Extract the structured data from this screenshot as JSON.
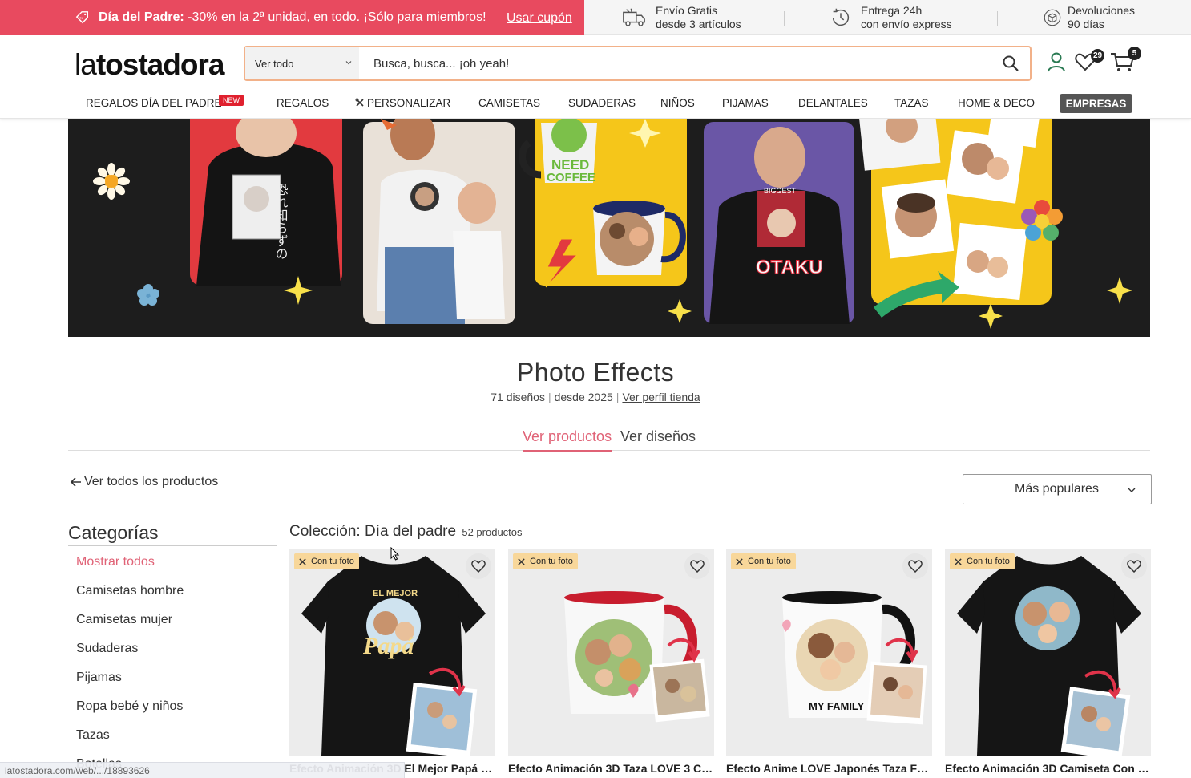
{
  "promo": {
    "bold": "Día del Padre:",
    "text": " -30% en la 2ª unidad, en todo. ¡Sólo para miembros!",
    "coupon": "Usar cupón"
  },
  "perks": [
    {
      "line1": "Envío Gratis",
      "line2": "desde 3 artículos",
      "icon": "truck-icon"
    },
    {
      "line1": "Entrega 24h",
      "line2": "con envío express",
      "icon": "clock-icon"
    },
    {
      "line1": "Devoluciones",
      "line2": "90 días",
      "icon": "box-icon"
    }
  ],
  "header": {
    "logo_light": "la",
    "logo_bold": "tostadora",
    "search_category": "Ver todo",
    "search_placeholder": "Busca, busca... ¡oh yeah!",
    "wishlist_count": "29",
    "cart_count": "5"
  },
  "nav": {
    "items": [
      "REGALOS DÍA DEL PADRE",
      "REGALOS",
      "PERSONALIZAR",
      "CAMISETAS",
      "SUDADERAS",
      "NIÑOS",
      "PIJAMAS",
      "DELANTALES",
      "TAZAS",
      "HOME & DECO"
    ],
    "new_badge": "NEW",
    "empresas": "EMPRESAS"
  },
  "store": {
    "title": "Photo Effects",
    "designs": "71 diseños",
    "since": "desde 2025",
    "profile_link": "Ver perfil tienda"
  },
  "tabs": {
    "products": "Ver productos",
    "designs": "Ver diseños"
  },
  "back_link": "Ver todos los productos",
  "sort": {
    "selected": "Más populares"
  },
  "sidebar": {
    "title": "Categorías",
    "items": [
      "Mostrar todos",
      "Camisetas hombre",
      "Camisetas mujer",
      "Sudaderas",
      "Pijamas",
      "Ropa bebé y niños",
      "Tazas",
      "Botellas"
    ]
  },
  "collection": {
    "title": "Colección: Día del padre",
    "count": "52 productos"
  },
  "products": [
    {
      "tag": "Con tu foto",
      "name": "Efecto Animación 3D El Mejor Papá C..."
    },
    {
      "tag": "Con tu foto",
      "name": "Efecto Animación 3D Taza LOVE 3 Cor..."
    },
    {
      "tag": "Con tu foto",
      "name": "Efecto Anime LOVE Japonés Taza Fot..."
    },
    {
      "tag": "Con tu foto",
      "name": "Efecto Animación 3D Camiseta Con F..."
    }
  ],
  "product_art": {
    "p1_line1": "EL MEJOR",
    "p1_line2": "Papá",
    "p3_text": "MY FAMILY"
  },
  "banner_art": {
    "mug_text_1": "NEED",
    "mug_text_2": "COFFEE",
    "shirt_text": "OTAKU",
    "shirt_top": "BIGGEST"
  },
  "status_url": "latostadora.com/web/.../18893626",
  "colors": {
    "promo_red": "#e84a5f",
    "accent_pink": "#e06276",
    "search_border": "#f2b189",
    "tag_yellow": "#f8d79a"
  }
}
